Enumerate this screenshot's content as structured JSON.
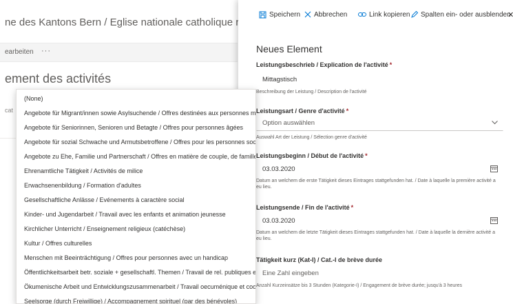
{
  "background": {
    "site_title": "ne des Kantons Bern / Eglise nationale catholique romaine",
    "edit_label": "earbeiten",
    "more_label": "···",
    "list_title": "ement des activités",
    "column_hint": "cat"
  },
  "toolbar": {
    "save": "Speichern",
    "cancel": "Abbrechen",
    "copy_link": "Link kopieren",
    "columns": "Spalten ein- oder ausblenden",
    "close": "✕"
  },
  "form": {
    "title": "Neues Element",
    "fields": [
      {
        "label": "Leistungsbeschrieb / Explication de l'activité",
        "required": true,
        "value": "Mittagstisch",
        "description": "Beschreibung der Leistung / Description de l'activité"
      },
      {
        "label": "Leistungsart / Genre d'activité",
        "required": true,
        "placeholder": "Option auswählen",
        "description": "Auswahl Art der Leistung / Sélection genre d'activité"
      },
      {
        "label": "Leistungsbeginn / Début de l'activité",
        "required": true,
        "value": "03.03.2020",
        "description": "Datum an welchem die erste Tätigkeit dieses Eintrages stattgefunden hat. / Date à laquelle la première activité a eu lieu."
      },
      {
        "label": "Leistungsende / Fin de l'activité",
        "required": true,
        "value": "03.03.2020",
        "description": "Datum an welchem die letzte Tätigkeit dieses Eintrages stattgefunden hat. / Date à laquelle la dernière activité a eu lieu."
      },
      {
        "label": "Tätigkeit kurz (Kat-I) / Cat.-I de brève durée",
        "required": false,
        "placeholder": "Eine Zahl eingeben",
        "description": "Anzahl Kurzeinsätze bis 3 Stunden (Kategorie-I) / Engagement de brève durée; jusqu'à 3 heures"
      }
    ]
  },
  "dropdown": {
    "options": [
      "(None)",
      "Angebote für Migrant/innen sowie Asylsuchende / Offres destinées aux personnes migrantes et requérantes d'asile",
      "Angebote für Seniorinnen, Senioren und Betagte / Offres pour personnes âgées",
      "Angebote für sozial Schwache und Armutsbetroffene / Offres pour les personnes socialement défavorisées",
      "Angebote zu Ehe, Familie und Partnerschaft / Offres en matière de couple, de famille",
      "Ehrenamtliche Tätigkeit / Activités de milice",
      "Erwachsenenbildung / Formation d'adultes",
      "Gesellschaftliche Anlässe / Evénements à caractère social",
      "Kinder- und Jugendarbeit / Travail avec les enfants et animation jeunesse",
      "Kirchlicher Unterricht / Enseignement religieux (catéchèse)",
      "Kultur / Offres culturelles",
      "Menschen mit Beeinträchtigung / Offres pour personnes avec un handicap",
      "Öffentlichkeitsarbeit betr. soziale + gesellschaftl. Themen / Travail de rel. publiques et sociales",
      "Ökumenische Arbeit und Entwicklungszusammenarbeit / Travail oecuménique et coopération",
      "Seelsorge (durch Freiwillige) / Accompagnement spirituel (par des bénévoles)"
    ]
  },
  "colors": {
    "accent": "#0078d4",
    "required": "#a4262c",
    "text": "#323130",
    "muted": "#605e5c"
  }
}
